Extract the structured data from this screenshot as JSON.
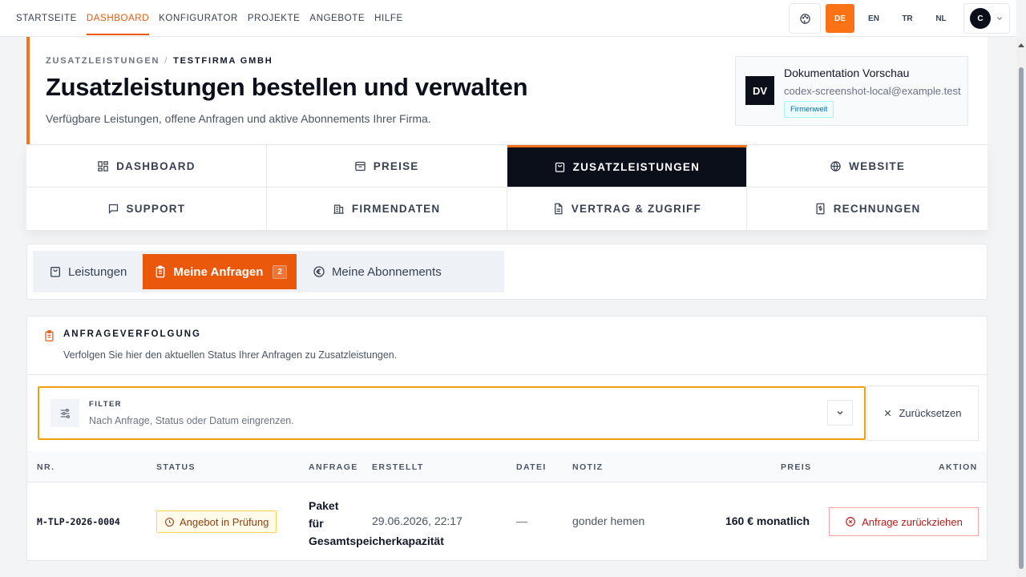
{
  "topnav": {
    "links": [
      "STARTSEITE",
      "DASHBOARD",
      "KONFIGURATOR",
      "PROJEKTE",
      "ANGEBOTE",
      "HILFE"
    ],
    "active_index": 1,
    "languages": [
      "DE",
      "EN",
      "TR",
      "NL"
    ],
    "active_language": "DE",
    "avatar_initial": "C"
  },
  "header": {
    "breadcrumb": [
      "ZUSATZLEISTUNGEN",
      "TESTFIRMA GMBH"
    ],
    "breadcrumb_sep": "/",
    "title": "Zusatzleistungen bestellen und verwalten",
    "subtitle": "Verfügbare Leistungen, offene Anfragen und aktive Abonnements Ihrer Firma.",
    "profile": {
      "initials": "DV",
      "name": "Dokumentation Vorschau",
      "email": "codex-screenshot-local@example.test",
      "badge": "Firmenweit"
    }
  },
  "section_nav": [
    {
      "label": "DASHBOARD",
      "icon": "dashboard-grid-icon"
    },
    {
      "label": "PREISE",
      "icon": "box-icon"
    },
    {
      "label": "ZUSATZLEISTUNGEN",
      "icon": "shopping-bag-icon",
      "active": true
    },
    {
      "label": "WEBSITE",
      "icon": "globe-icon"
    },
    {
      "label": "SUPPORT",
      "icon": "chat-icon"
    },
    {
      "label": "FIRMENDATEN",
      "icon": "building-icon"
    },
    {
      "label": "VERTRAG & ZUGRIFF",
      "icon": "document-icon"
    },
    {
      "label": "RECHNUNGEN",
      "icon": "invoice-icon"
    }
  ],
  "tabs": [
    {
      "label": "Leistungen",
      "icon": "shopping-bag-icon"
    },
    {
      "label": "Meine Anfragen",
      "icon": "clipboard-icon",
      "count": "2",
      "active": true
    },
    {
      "label": "Meine Abonnements",
      "icon": "euro-icon"
    }
  ],
  "tracking": {
    "title": "ANFRAGEVERFOLGUNG",
    "subtitle": "Verfolgen Sie hier den aktuellen Status Ihrer Anfragen zu Zusatzleistungen.",
    "filter_label": "FILTER",
    "filter_hint": "Nach Anfrage, Status oder Datum eingrenzen.",
    "reset_label": "Zurücksetzen"
  },
  "table": {
    "headers": [
      "NR.",
      "STATUS",
      "ANFRAGE",
      "ERSTELLT",
      "DATEI",
      "NOTIZ",
      "PREIS",
      "AKTION"
    ],
    "rows": [
      {
        "nr": "M-TLP-2026-0004",
        "status": "Angebot in Prüfung",
        "anfrage_lines": [
          "Paket",
          "für",
          "Gesamtspeicherkapazität"
        ],
        "erstellt": "29.06.2026, 22:17",
        "datei": "—",
        "notiz": "gonder hemen",
        "preis": "160 € monatlich",
        "aktion": "Anfrage zurückziehen"
      }
    ]
  },
  "colors": {
    "accent": "#ea580c",
    "dark": "#0b0f1a",
    "warning_border": "#f59e0b",
    "danger": "#b91c1c"
  }
}
